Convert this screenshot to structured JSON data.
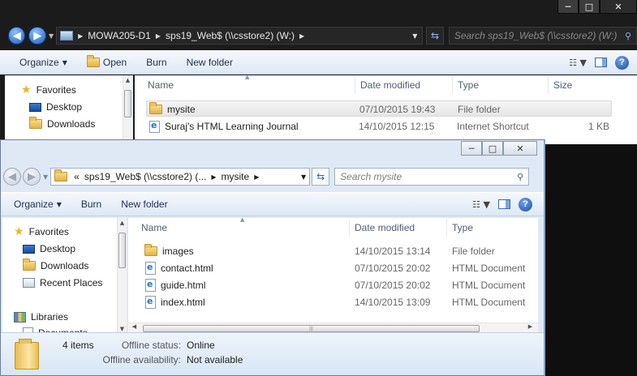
{
  "back_window": {
    "caption": {
      "minimize": "─",
      "maximize": "□",
      "close": "✕"
    },
    "address": {
      "crumbs": [
        "MOWA205-D1",
        "sps19_Web$ (\\\\csstore2) (W:)"
      ],
      "search_placeholder": "Search sps19_Web$ (\\\\csstore2) (W:)"
    },
    "toolbar": {
      "organize": "Organize",
      "open": "Open",
      "burn": "Burn",
      "new_folder": "New folder"
    },
    "nav": [
      {
        "label": "Favorites",
        "icon": "star-icon"
      },
      {
        "label": "Desktop",
        "icon": "desktop-icon"
      },
      {
        "label": "Downloads",
        "icon": "downloads-icon"
      }
    ],
    "columns": {
      "name": "Name",
      "date": "Date modified",
      "type": "Type",
      "size": "Size"
    },
    "files": [
      {
        "name": "mysite",
        "date": "07/10/2015 19:43",
        "type": "File folder",
        "size": "",
        "icon": "folder-icon",
        "selected": true
      },
      {
        "name": "Suraj's HTML Learning Journal",
        "date": "14/10/2015 12:15",
        "type": "Internet Shortcut",
        "size": "1 KB",
        "icon": "internet-shortcut-icon",
        "selected": false
      }
    ]
  },
  "front_window": {
    "caption": {
      "minimize": "─",
      "maximize": "□",
      "close": "✕"
    },
    "address": {
      "prefix": "«",
      "crumbs": [
        "sps19_Web$ (\\\\csstore2) (...",
        "mysite"
      ],
      "search_placeholder": "Search mysite"
    },
    "toolbar": {
      "organize": "Organize",
      "burn": "Burn",
      "new_folder": "New folder"
    },
    "nav": [
      {
        "label": "Favorites",
        "icon": "star-icon"
      },
      {
        "label": "Desktop",
        "icon": "desktop-icon"
      },
      {
        "label": "Downloads",
        "icon": "downloads-icon"
      },
      {
        "label": "Recent Places",
        "icon": "recent-places-icon"
      },
      {
        "label": "Libraries",
        "icon": "libraries-icon"
      },
      {
        "label": "Documents",
        "icon": "documents-icon"
      }
    ],
    "columns": {
      "name": "Name",
      "date": "Date modified",
      "type": "Type"
    },
    "files": [
      {
        "name": "images",
        "date": "14/10/2015 13:14",
        "type": "File folder",
        "icon": "folder-icon"
      },
      {
        "name": "contact.html",
        "date": "07/10/2015 20:02",
        "type": "HTML Document",
        "icon": "html-file-icon"
      },
      {
        "name": "guide.html",
        "date": "07/10/2015 20:02",
        "type": "HTML Document",
        "icon": "html-file-icon"
      },
      {
        "name": "index.html",
        "date": "14/10/2015 13:09",
        "type": "HTML Document",
        "icon": "html-file-icon"
      }
    ],
    "details": {
      "count": "4 items",
      "offline_status_label": "Offline status:",
      "offline_status_value": "Online",
      "offline_availability_label": "Offline availability:",
      "offline_availability_value": "Not available"
    }
  }
}
